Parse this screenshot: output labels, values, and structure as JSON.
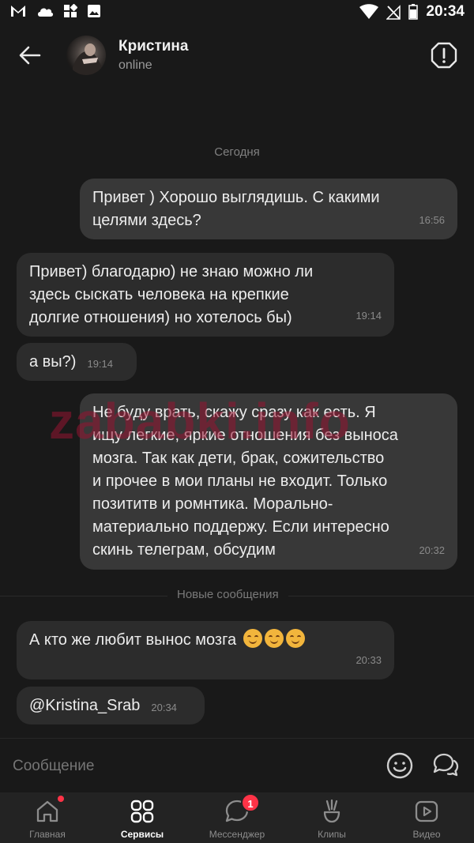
{
  "status_bar": {
    "time": "20:34"
  },
  "header": {
    "name": "Кристина",
    "presence": "online"
  },
  "date_separator": "Сегодня",
  "messages": [
    {
      "text": "Привет ) Хорошо выглядишь. С какими\nцелями здесь?",
      "time": "16:56",
      "dir": "out"
    },
    {
      "text": "Привет) благодарю) не знаю можно ли\nздесь сыскать человека на крепкие\nдолгие отношения) но хотелось бы)",
      "time": "19:14",
      "dir": "in"
    },
    {
      "text": "а вы?)",
      "time": "19:14",
      "dir": "in"
    },
    {
      "text": "Не буду врать, скажу сразу как есть. Я\nищу легкие, яркие отношения без выноса\nмозга. Так как дети, брак, сожительство\nи прочее в мои планы не входит. Только\nпозититв и ромнтика. Морально-\nматериально поддержу. Если интересно\nскинь телеграм, обсудим",
      "time": "20:32",
      "dir": "out"
    },
    {
      "text": "А кто же любит вынос мозга",
      "time": "20:33",
      "dir": "in"
    },
    {
      "text": "@Kristina_Srab",
      "time": "20:34",
      "dir": "in"
    }
  ],
  "new_messages_label": "Новые сообщения",
  "composer": {
    "placeholder": "Сообщение"
  },
  "watermark": "zababki.info",
  "nav": {
    "items": [
      {
        "label": "Главная"
      },
      {
        "label": "Сервисы"
      },
      {
        "label": "Мессенджер"
      },
      {
        "label": "Клипы"
      },
      {
        "label": "Видео"
      }
    ],
    "messenger_badge": "1"
  },
  "icons": [
    "gmail-icon",
    "cloud-icon",
    "apps-icon",
    "image-icon",
    "wifi-icon",
    "no-signal-icon",
    "battery-icon",
    "back-arrow-icon",
    "report-icon",
    "emoji-icon",
    "chats-icon",
    "home-icon",
    "services-icon",
    "messenger-icon",
    "clips-icon",
    "video-icon"
  ],
  "colors": {
    "background": "#191919",
    "bubble_out": "#383838",
    "bubble_in": "#2c2c2c",
    "badge": "#ff3347"
  }
}
